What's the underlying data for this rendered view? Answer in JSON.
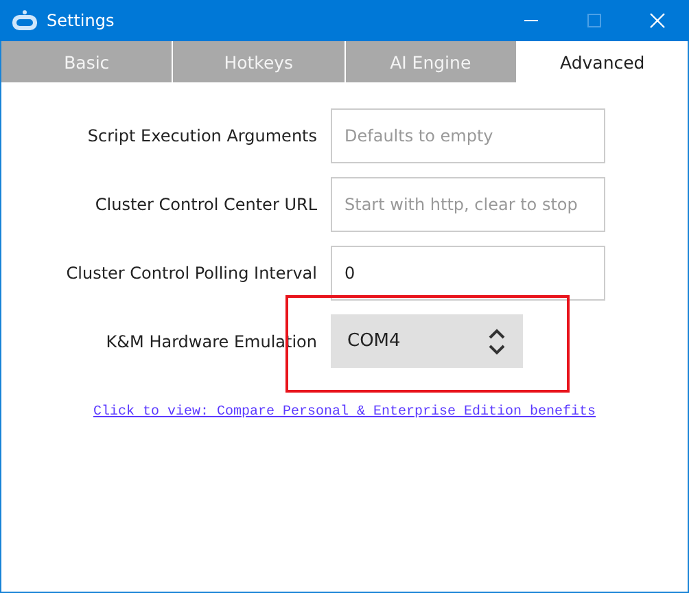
{
  "window": {
    "title": "Settings"
  },
  "tabs": [
    {
      "label": "Basic",
      "selected": false
    },
    {
      "label": "Hotkeys",
      "selected": false
    },
    {
      "label": "AI Engine",
      "selected": false
    },
    {
      "label": "Advanced",
      "selected": true
    }
  ],
  "fields": [
    {
      "kind": "text",
      "label": "Script Execution Arguments",
      "placeholder": "Defaults to empty",
      "highlighted": false
    },
    {
      "kind": "text",
      "label": "Cluster Control Center URL",
      "placeholder": "Start with http, clear to stop",
      "highlighted": false
    },
    {
      "kind": "text",
      "label": "Cluster Control Polling Interval",
      "value": "0",
      "highlighted": false
    },
    {
      "kind": "select",
      "label": "K&M Hardware Emulation",
      "value": "COM4",
      "highlighted": true
    }
  ],
  "link": "Click to view: Compare Personal & Enterprise Edition benefits"
}
